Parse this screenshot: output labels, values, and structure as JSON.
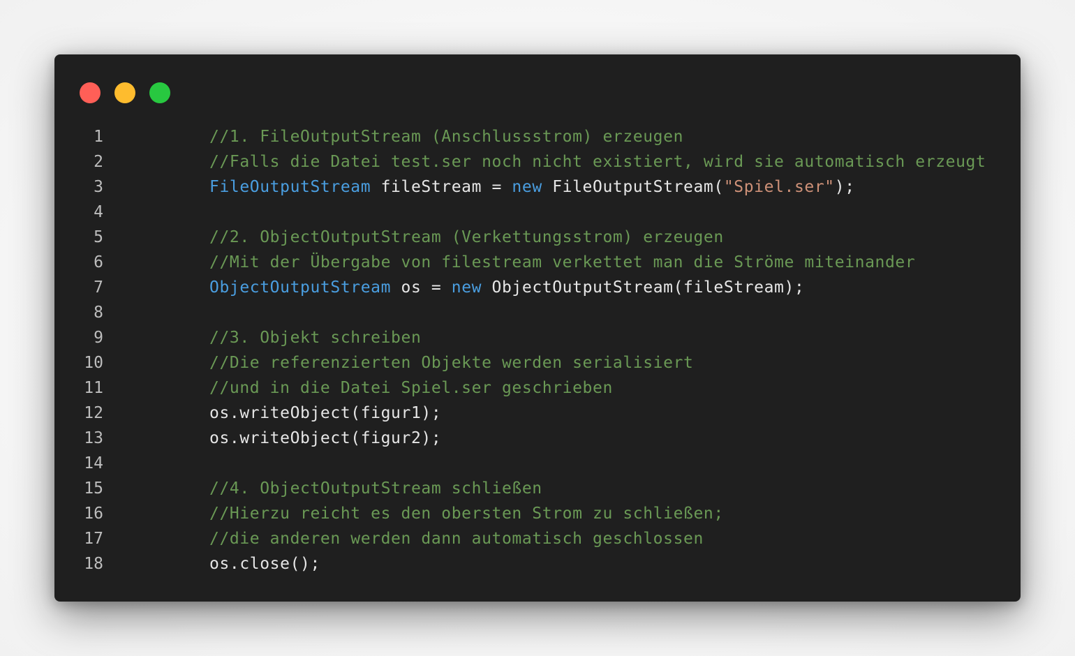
{
  "window": {
    "controls": [
      {
        "name": "close-button",
        "color": "#ff5f57"
      },
      {
        "name": "minimize-button",
        "color": "#febc2e"
      },
      {
        "name": "maximize-button",
        "color": "#28c840"
      }
    ]
  },
  "colors": {
    "background": "#1f1f1f",
    "comment": "#6a9955",
    "type": "#4a9ee0",
    "keyword": "#4a9ee0",
    "string": "#ce9178",
    "plain": "#e6e6e6",
    "line_number": "#bdbdbd"
  },
  "code": {
    "lines": [
      {
        "number": "1",
        "tokens": [
          {
            "type": "comment",
            "text": "//1. FileOutputStream (Anschlussstrom) erzeugen"
          }
        ]
      },
      {
        "number": "2",
        "tokens": [
          {
            "type": "comment",
            "text": "//Falls die Datei test.ser noch nicht existiert, wird sie automatisch erzeugt"
          }
        ]
      },
      {
        "number": "3",
        "tokens": [
          {
            "type": "type",
            "text": "FileOutputStream"
          },
          {
            "type": "plain",
            "text": " fileStream = "
          },
          {
            "type": "keyword",
            "text": "new"
          },
          {
            "type": "plain",
            "text": " FileOutputStream("
          },
          {
            "type": "string",
            "text": "\"Spiel.ser\""
          },
          {
            "type": "plain",
            "text": ");"
          }
        ]
      },
      {
        "number": "4",
        "tokens": []
      },
      {
        "number": "5",
        "tokens": [
          {
            "type": "comment",
            "text": "//2. ObjectOutputStream (Verkettungsstrom) erzeugen"
          }
        ]
      },
      {
        "number": "6",
        "tokens": [
          {
            "type": "comment",
            "text": "//Mit der Übergabe von filestream verkettet man die Ströme miteinander"
          }
        ]
      },
      {
        "number": "7",
        "tokens": [
          {
            "type": "type",
            "text": "ObjectOutputStream"
          },
          {
            "type": "plain",
            "text": " os = "
          },
          {
            "type": "keyword",
            "text": "new"
          },
          {
            "type": "plain",
            "text": " ObjectOutputStream(fileStream);"
          }
        ]
      },
      {
        "number": "8",
        "tokens": []
      },
      {
        "number": "9",
        "tokens": [
          {
            "type": "comment",
            "text": "//3. Objekt schreiben"
          }
        ]
      },
      {
        "number": "10",
        "tokens": [
          {
            "type": "comment",
            "text": "//Die referenzierten Objekte werden serialisiert"
          }
        ]
      },
      {
        "number": "11",
        "tokens": [
          {
            "type": "comment",
            "text": "//und in die Datei Spiel.ser geschrieben"
          }
        ]
      },
      {
        "number": "12",
        "tokens": [
          {
            "type": "plain",
            "text": "os.writeObject(figur1);"
          }
        ]
      },
      {
        "number": "13",
        "tokens": [
          {
            "type": "plain",
            "text": "os.writeObject(figur2);"
          }
        ]
      },
      {
        "number": "14",
        "tokens": []
      },
      {
        "number": "15",
        "tokens": [
          {
            "type": "comment",
            "text": "//4. ObjectOutputStream schließen"
          }
        ]
      },
      {
        "number": "16",
        "tokens": [
          {
            "type": "comment",
            "text": "//Hierzu reicht es den obersten Strom zu schließen;"
          }
        ]
      },
      {
        "number": "17",
        "tokens": [
          {
            "type": "comment",
            "text": "//die anderen werden dann automatisch geschlossen"
          }
        ]
      },
      {
        "number": "18",
        "tokens": [
          {
            "type": "plain",
            "text": "os.close();"
          }
        ]
      }
    ]
  }
}
